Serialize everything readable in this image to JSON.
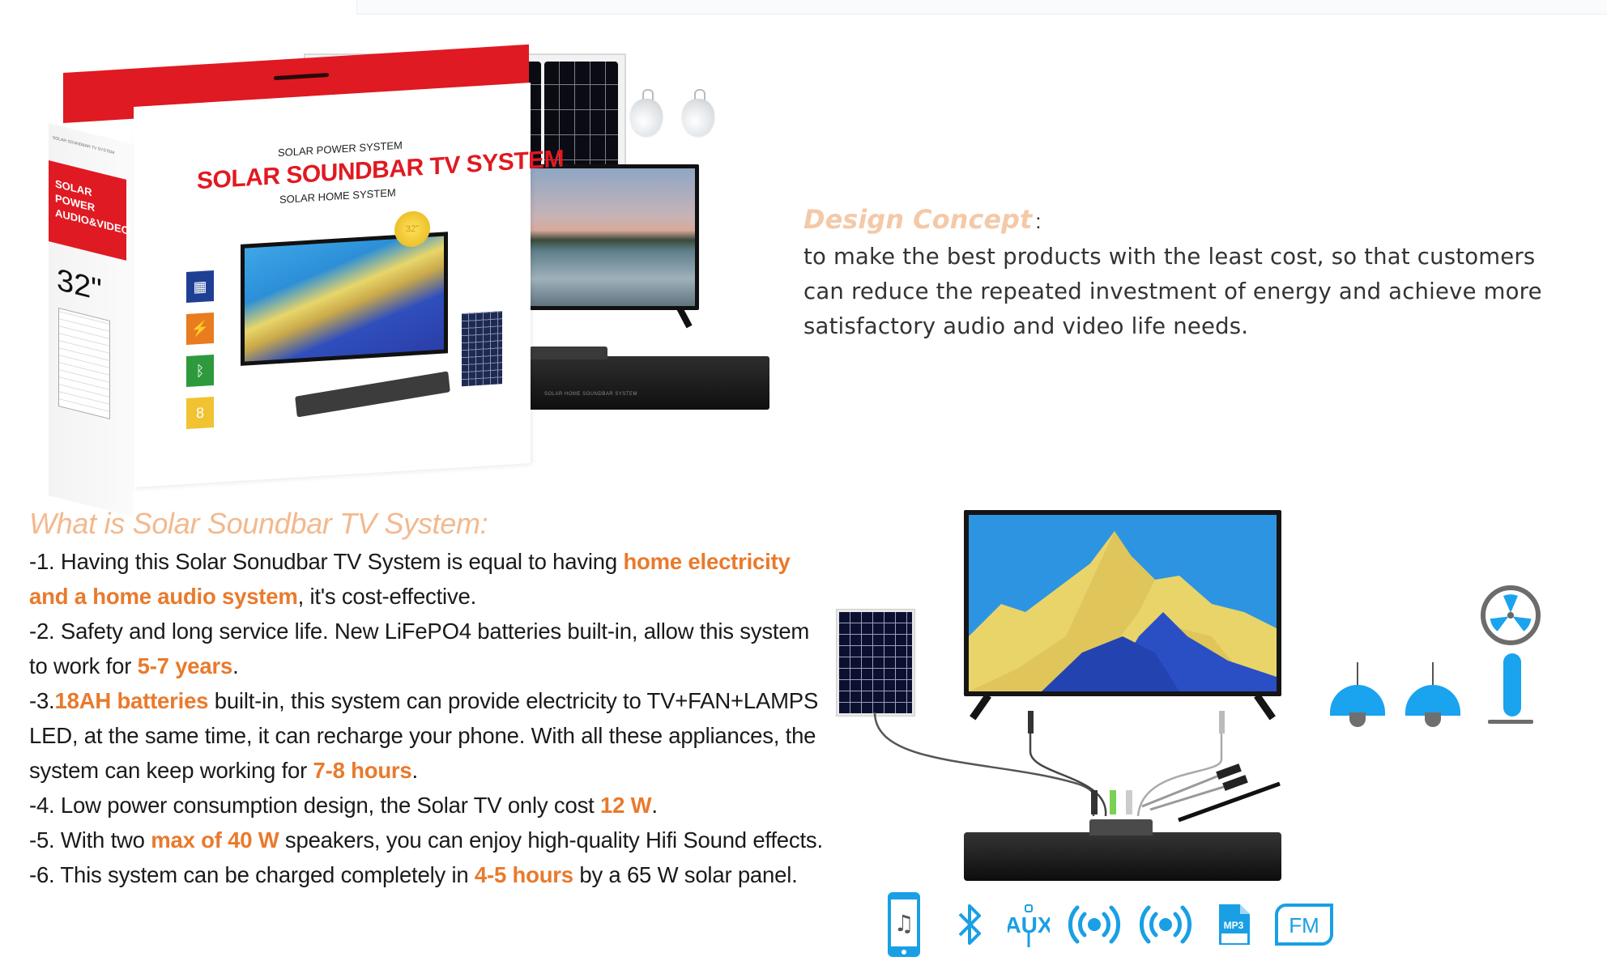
{
  "product_photo": {
    "box_side_small": "SOLAR SOUNDBAR TV SYSTEM",
    "box_side_badge_line1": "SOLAR POWER",
    "box_side_badge_line2": "AUDIO&VIDEO",
    "box_side_size": "32\"",
    "box_front_subtitle_top": "SOLAR POWER SYSTEM",
    "box_front_title": "SOLAR SOUNDBAR TV SYSTEM",
    "box_front_subtitle_bottom": "SOLAR HOME SYSTEM",
    "medal_label": "32\"",
    "box_icons": [
      {
        "name": "solar-panel-icon",
        "color": "#1f3f94"
      },
      {
        "name": "phone-charge-icon",
        "color": "#e87c1e"
      },
      {
        "name": "bluetooth-icon",
        "color": "#2e9a3d"
      },
      {
        "name": "battery-8-icon",
        "color": "#f1c232",
        "label": "8"
      }
    ],
    "brand_red": "#e01a22"
  },
  "design_concept": {
    "title": "Design Concept",
    "colon": ":",
    "lines": [
      "to make the best products with the least cost, so that customers",
      "can reduce the repeated investment of energy and achieve more",
      "satisfactory audio and video life needs."
    ]
  },
  "description": {
    "title": "What is Solar Soundbar TV System:",
    "items": [
      {
        "prefix": "-1. Having this Solar Sonudbar TV System is equal to having ",
        "highlight": "home electricity and a home audio system",
        "suffix": ", it's cost-effective."
      },
      {
        "prefix": "-2. Safety and long service life. New LiFePO4 batteries built-in, allow this system to work for ",
        "highlight": "5-7 years",
        "suffix": "."
      },
      {
        "prefix": "-3.",
        "highlight": "18AH batteries",
        "middle": " built-in, this system can provide electricity to TV+FAN+LAMPS LED, at the same time, it can recharge your phone. With all these appliances, the system can keep working for ",
        "highlight2": "7-8 hours",
        "suffix": "."
      },
      {
        "prefix": "-4. Low power consumption design, the Solar TV only cost ",
        "highlight": "12 W",
        "suffix": "."
      },
      {
        "prefix": "-5. With two ",
        "highlight": "max of 40 W",
        "suffix": " speakers, you can enjoy high-quality Hifi Sound effects."
      },
      {
        "prefix": "-6. This system can be charged completely in ",
        "highlight": "4-5 hours",
        "suffix": " by a 65 W solar panel."
      }
    ],
    "highlight_color": "#e97a2c",
    "title_color": "#f2b98e"
  },
  "diagram": {
    "devices": [
      "solar-panel",
      "tv",
      "soundbar",
      "lamp",
      "lamp",
      "fan"
    ],
    "accent": "#1aa3ee"
  },
  "features": {
    "icons": [
      {
        "name": "phone-music-icon"
      },
      {
        "name": "bluetooth-icon"
      },
      {
        "name": "aux-icon",
        "label": "AUX"
      },
      {
        "name": "wireless-broadcast-icon"
      },
      {
        "name": "wireless-broadcast-icon"
      },
      {
        "name": "mp3-file-icon",
        "label": "MP3"
      },
      {
        "name": "fm-radio-icon",
        "label": "FM"
      }
    ],
    "color": "#1a9fe5"
  }
}
